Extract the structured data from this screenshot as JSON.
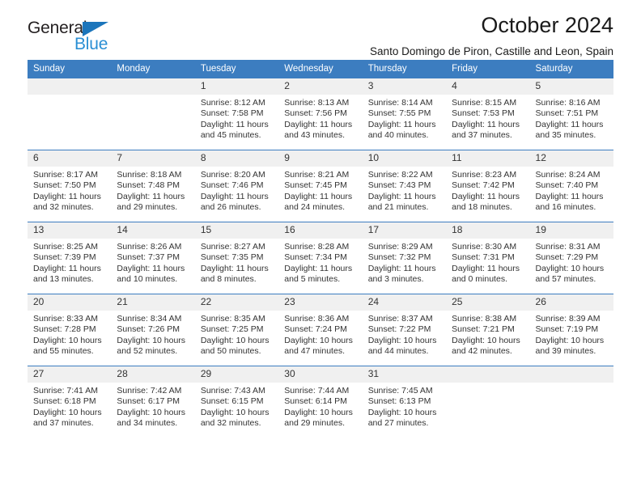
{
  "brand": {
    "name_part1": "General",
    "name_part2": "Blue",
    "triangle_color": "#1b75bb",
    "blue_color": "#2b8fd4"
  },
  "header": {
    "month_title": "October 2024",
    "location": "Santo Domingo de Piron, Castille and Leon, Spain",
    "header_bg_color": "#3c7dc0",
    "daynum_bg_color": "#f0f0f0"
  },
  "weekdays": [
    "Sunday",
    "Monday",
    "Tuesday",
    "Wednesday",
    "Thursday",
    "Friday",
    "Saturday"
  ],
  "calendar": {
    "weeks": [
      [
        {
          "day": "",
          "empty": true,
          "sunrise": "",
          "sunset": "",
          "daylight_line1": "",
          "daylight_line2": ""
        },
        {
          "day": "",
          "empty": true,
          "sunrise": "",
          "sunset": "",
          "daylight_line1": "",
          "daylight_line2": ""
        },
        {
          "day": "1",
          "empty": false,
          "sunrise": "Sunrise: 8:12 AM",
          "sunset": "Sunset: 7:58 PM",
          "daylight_line1": "Daylight: 11 hours",
          "daylight_line2": "and 45 minutes."
        },
        {
          "day": "2",
          "empty": false,
          "sunrise": "Sunrise: 8:13 AM",
          "sunset": "Sunset: 7:56 PM",
          "daylight_line1": "Daylight: 11 hours",
          "daylight_line2": "and 43 minutes."
        },
        {
          "day": "3",
          "empty": false,
          "sunrise": "Sunrise: 8:14 AM",
          "sunset": "Sunset: 7:55 PM",
          "daylight_line1": "Daylight: 11 hours",
          "daylight_line2": "and 40 minutes."
        },
        {
          "day": "4",
          "empty": false,
          "sunrise": "Sunrise: 8:15 AM",
          "sunset": "Sunset: 7:53 PM",
          "daylight_line1": "Daylight: 11 hours",
          "daylight_line2": "and 37 minutes."
        },
        {
          "day": "5",
          "empty": false,
          "sunrise": "Sunrise: 8:16 AM",
          "sunset": "Sunset: 7:51 PM",
          "daylight_line1": "Daylight: 11 hours",
          "daylight_line2": "and 35 minutes."
        }
      ],
      [
        {
          "day": "6",
          "empty": false,
          "sunrise": "Sunrise: 8:17 AM",
          "sunset": "Sunset: 7:50 PM",
          "daylight_line1": "Daylight: 11 hours",
          "daylight_line2": "and 32 minutes."
        },
        {
          "day": "7",
          "empty": false,
          "sunrise": "Sunrise: 8:18 AM",
          "sunset": "Sunset: 7:48 PM",
          "daylight_line1": "Daylight: 11 hours",
          "daylight_line2": "and 29 minutes."
        },
        {
          "day": "8",
          "empty": false,
          "sunrise": "Sunrise: 8:20 AM",
          "sunset": "Sunset: 7:46 PM",
          "daylight_line1": "Daylight: 11 hours",
          "daylight_line2": "and 26 minutes."
        },
        {
          "day": "9",
          "empty": false,
          "sunrise": "Sunrise: 8:21 AM",
          "sunset": "Sunset: 7:45 PM",
          "daylight_line1": "Daylight: 11 hours",
          "daylight_line2": "and 24 minutes."
        },
        {
          "day": "10",
          "empty": false,
          "sunrise": "Sunrise: 8:22 AM",
          "sunset": "Sunset: 7:43 PM",
          "daylight_line1": "Daylight: 11 hours",
          "daylight_line2": "and 21 minutes."
        },
        {
          "day": "11",
          "empty": false,
          "sunrise": "Sunrise: 8:23 AM",
          "sunset": "Sunset: 7:42 PM",
          "daylight_line1": "Daylight: 11 hours",
          "daylight_line2": "and 18 minutes."
        },
        {
          "day": "12",
          "empty": false,
          "sunrise": "Sunrise: 8:24 AM",
          "sunset": "Sunset: 7:40 PM",
          "daylight_line1": "Daylight: 11 hours",
          "daylight_line2": "and 16 minutes."
        }
      ],
      [
        {
          "day": "13",
          "empty": false,
          "sunrise": "Sunrise: 8:25 AM",
          "sunset": "Sunset: 7:39 PM",
          "daylight_line1": "Daylight: 11 hours",
          "daylight_line2": "and 13 minutes."
        },
        {
          "day": "14",
          "empty": false,
          "sunrise": "Sunrise: 8:26 AM",
          "sunset": "Sunset: 7:37 PM",
          "daylight_line1": "Daylight: 11 hours",
          "daylight_line2": "and 10 minutes."
        },
        {
          "day": "15",
          "empty": false,
          "sunrise": "Sunrise: 8:27 AM",
          "sunset": "Sunset: 7:35 PM",
          "daylight_line1": "Daylight: 11 hours",
          "daylight_line2": "and 8 minutes."
        },
        {
          "day": "16",
          "empty": false,
          "sunrise": "Sunrise: 8:28 AM",
          "sunset": "Sunset: 7:34 PM",
          "daylight_line1": "Daylight: 11 hours",
          "daylight_line2": "and 5 minutes."
        },
        {
          "day": "17",
          "empty": false,
          "sunrise": "Sunrise: 8:29 AM",
          "sunset": "Sunset: 7:32 PM",
          "daylight_line1": "Daylight: 11 hours",
          "daylight_line2": "and 3 minutes."
        },
        {
          "day": "18",
          "empty": false,
          "sunrise": "Sunrise: 8:30 AM",
          "sunset": "Sunset: 7:31 PM",
          "daylight_line1": "Daylight: 11 hours",
          "daylight_line2": "and 0 minutes."
        },
        {
          "day": "19",
          "empty": false,
          "sunrise": "Sunrise: 8:31 AM",
          "sunset": "Sunset: 7:29 PM",
          "daylight_line1": "Daylight: 10 hours",
          "daylight_line2": "and 57 minutes."
        }
      ],
      [
        {
          "day": "20",
          "empty": false,
          "sunrise": "Sunrise: 8:33 AM",
          "sunset": "Sunset: 7:28 PM",
          "daylight_line1": "Daylight: 10 hours",
          "daylight_line2": "and 55 minutes."
        },
        {
          "day": "21",
          "empty": false,
          "sunrise": "Sunrise: 8:34 AM",
          "sunset": "Sunset: 7:26 PM",
          "daylight_line1": "Daylight: 10 hours",
          "daylight_line2": "and 52 minutes."
        },
        {
          "day": "22",
          "empty": false,
          "sunrise": "Sunrise: 8:35 AM",
          "sunset": "Sunset: 7:25 PM",
          "daylight_line1": "Daylight: 10 hours",
          "daylight_line2": "and 50 minutes."
        },
        {
          "day": "23",
          "empty": false,
          "sunrise": "Sunrise: 8:36 AM",
          "sunset": "Sunset: 7:24 PM",
          "daylight_line1": "Daylight: 10 hours",
          "daylight_line2": "and 47 minutes."
        },
        {
          "day": "24",
          "empty": false,
          "sunrise": "Sunrise: 8:37 AM",
          "sunset": "Sunset: 7:22 PM",
          "daylight_line1": "Daylight: 10 hours",
          "daylight_line2": "and 44 minutes."
        },
        {
          "day": "25",
          "empty": false,
          "sunrise": "Sunrise: 8:38 AM",
          "sunset": "Sunset: 7:21 PM",
          "daylight_line1": "Daylight: 10 hours",
          "daylight_line2": "and 42 minutes."
        },
        {
          "day": "26",
          "empty": false,
          "sunrise": "Sunrise: 8:39 AM",
          "sunset": "Sunset: 7:19 PM",
          "daylight_line1": "Daylight: 10 hours",
          "daylight_line2": "and 39 minutes."
        }
      ],
      [
        {
          "day": "27",
          "empty": false,
          "sunrise": "Sunrise: 7:41 AM",
          "sunset": "Sunset: 6:18 PM",
          "daylight_line1": "Daylight: 10 hours",
          "daylight_line2": "and 37 minutes."
        },
        {
          "day": "28",
          "empty": false,
          "sunrise": "Sunrise: 7:42 AM",
          "sunset": "Sunset: 6:17 PM",
          "daylight_line1": "Daylight: 10 hours",
          "daylight_line2": "and 34 minutes."
        },
        {
          "day": "29",
          "empty": false,
          "sunrise": "Sunrise: 7:43 AM",
          "sunset": "Sunset: 6:15 PM",
          "daylight_line1": "Daylight: 10 hours",
          "daylight_line2": "and 32 minutes."
        },
        {
          "day": "30",
          "empty": false,
          "sunrise": "Sunrise: 7:44 AM",
          "sunset": "Sunset: 6:14 PM",
          "daylight_line1": "Daylight: 10 hours",
          "daylight_line2": "and 29 minutes."
        },
        {
          "day": "31",
          "empty": false,
          "sunrise": "Sunrise: 7:45 AM",
          "sunset": "Sunset: 6:13 PM",
          "daylight_line1": "Daylight: 10 hours",
          "daylight_line2": "and 27 minutes."
        },
        {
          "day": "",
          "empty": true,
          "sunrise": "",
          "sunset": "",
          "daylight_line1": "",
          "daylight_line2": ""
        },
        {
          "day": "",
          "empty": true,
          "sunrise": "",
          "sunset": "",
          "daylight_line1": "",
          "daylight_line2": ""
        }
      ]
    ]
  }
}
